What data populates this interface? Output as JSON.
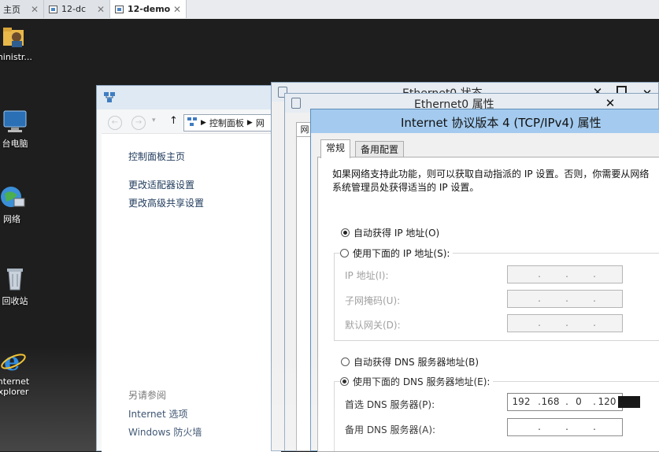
{
  "vm_tabs": [
    {
      "label": "主页",
      "active": false
    },
    {
      "label": "12-dc",
      "active": false
    },
    {
      "label": "12-demo",
      "active": true
    }
  ],
  "desktop_icons": [
    {
      "name": "administrator-folder-icon",
      "label": "ministr..."
    },
    {
      "name": "this-pc-icon",
      "label": "台电脑"
    },
    {
      "name": "network-icon",
      "label": "网络"
    },
    {
      "name": "recycle-bin-icon",
      "label": "回收站"
    },
    {
      "name": "internet-explorer-icon",
      "label": "nternet",
      "label2": "xplorer"
    }
  ],
  "control_panel": {
    "breadcrumb": "控制面板",
    "breadcrumb_next": "网",
    "home_link": "控制面板主页",
    "links": [
      "更改适配器设置",
      "更改高级共享设置"
    ],
    "see_also": "另请参阅",
    "see_also_links": [
      "Internet 选项",
      "Windows 防火墙"
    ]
  },
  "ethernet_status": {
    "title": "Ethernet0 状态"
  },
  "ethernet_props": {
    "title": "Ethernet0 属性",
    "tab_fragment": "网"
  },
  "ipv4": {
    "title": "Internet 协议版本 4 (TCP/IPv4) 属性",
    "tabs": [
      "常规",
      "备用配置"
    ],
    "description": "如果网络支持此功能，则可以获取自动指派的 IP 设置。否则，你需要从网络系统管理员处获得适当的 IP 设置。",
    "auto_ip": "自动获得 IP 地址(O)",
    "manual_ip": "使用下面的 IP 地址(S):",
    "ip_label": "IP 地址(I):",
    "mask_label": "子网掩码(U):",
    "gateway_label": "默认网关(D):",
    "auto_dns": "自动获得 DNS 服务器地址(B)",
    "manual_dns": "使用下面的 DNS 服务器地址(E):",
    "preferred_dns_label": "首选 DNS 服务器(P):",
    "alternate_dns_label": "备用 DNS 服务器(A):",
    "preferred_dns": [
      "192",
      "168",
      "0",
      "120"
    ],
    "selected_ip_mode": "auto",
    "selected_dns_mode": "manual"
  }
}
